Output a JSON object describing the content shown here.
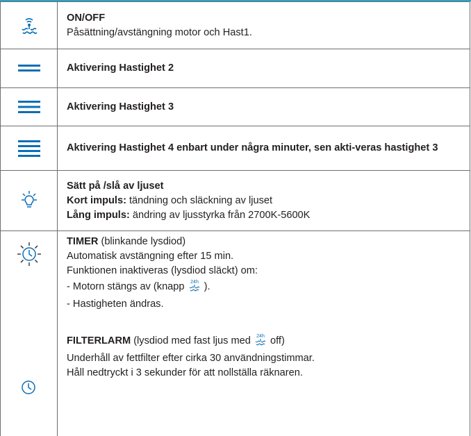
{
  "colors": {
    "accent": "#0b6eb5",
    "border": "#6d6e71",
    "topline": "#2aa3c3"
  },
  "rows": [
    {
      "icon": "fan-motor-icon",
      "title": "ON/OFF",
      "desc": "Påsättning/avstängning motor och Hast1."
    },
    {
      "icon": "speed-2-lines-icon",
      "title": "Aktivering Hastighet 2"
    },
    {
      "icon": "speed-3-lines-icon",
      "title": "Aktivering Hastighet 3"
    },
    {
      "icon": "speed-4-lines-icon",
      "title": "Aktivering Hastighet 4 enbart under några minuter, sen akti-veras hastighet 3"
    },
    {
      "icon": "light-bulb-icon",
      "title": "Sätt på /slå av ljuset",
      "line1_bold": "Kort impuls:",
      "line1_rest": " tändning och släckning av ljuset",
      "line2_bold": "Lång impuls:",
      "line2_rest": " ändring av ljusstyrka från 2700K-5600K"
    },
    {
      "icon": "timer-blinking-icon",
      "title": "TIMER",
      "title_rest": " (blinkande lysdiod)",
      "l1": "Automatisk avstängning efter 15 min.",
      "l2": "Funktionen inaktiveras (lysdiod släckt) om:",
      "l3a": "- Motorn stängs av (knapp ",
      "l3b": " ).",
      "l4": "- Hastigheten ändras.",
      "badge": "24h"
    },
    {
      "icon": "clock-filter-icon",
      "title": "FILTERLARM",
      "title_rest_a": " (lysdiod med fast ljus med ",
      "title_rest_b": " off)",
      "l1": "Underhåll av fettfilter efter cirka 30 användningstimmar.",
      "l2": "Håll nedtryckt i 3 sekunder för att nollställa räknaren.",
      "badge": "24h"
    }
  ]
}
